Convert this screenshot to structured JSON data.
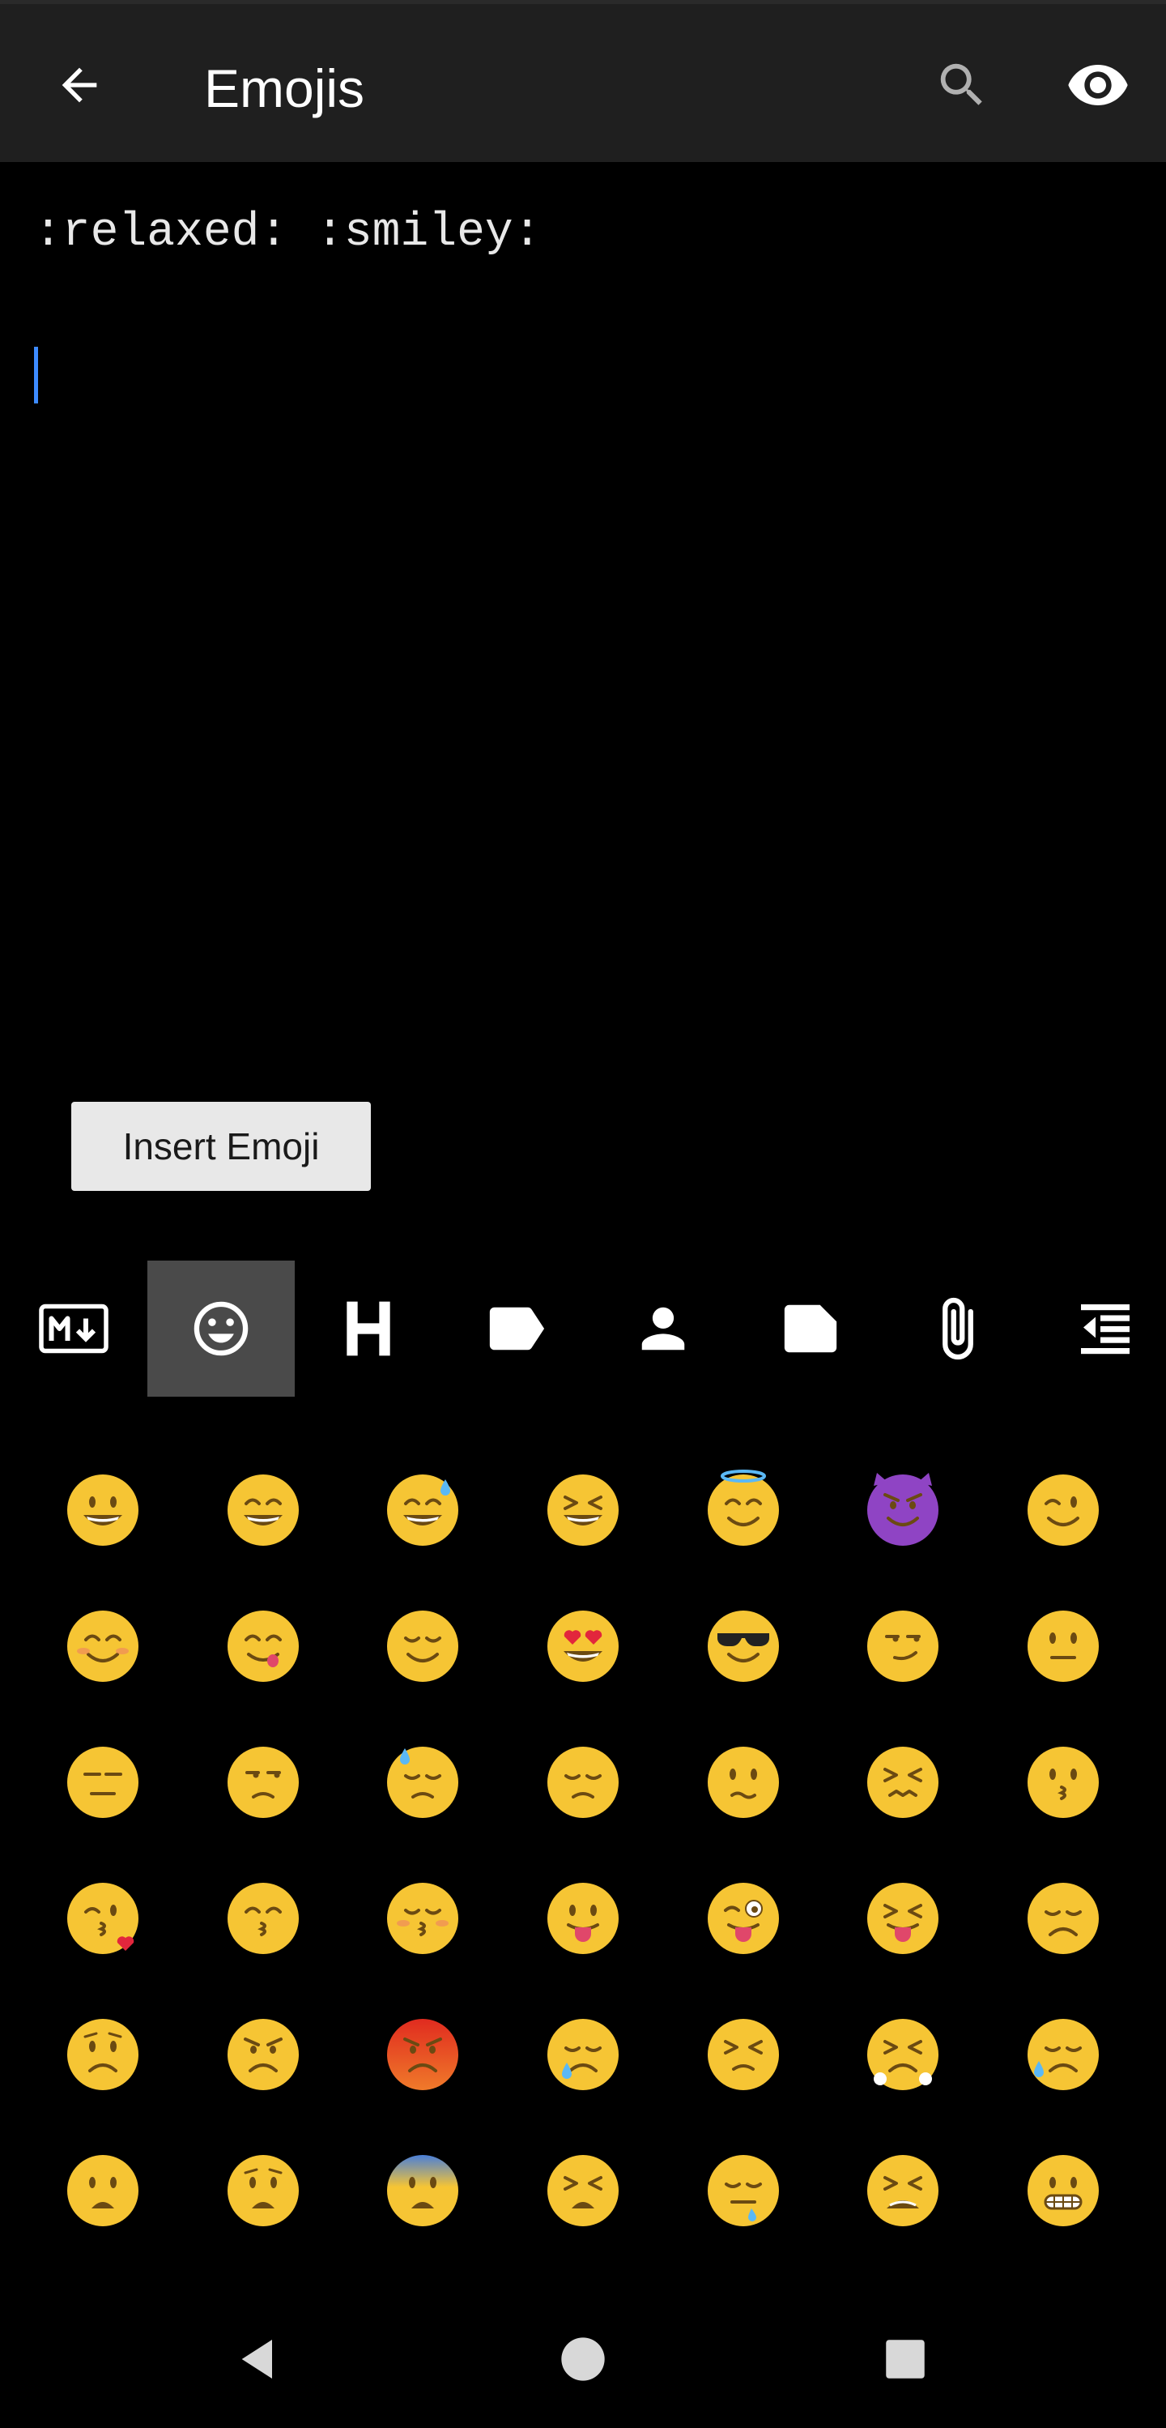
{
  "app_bar": {
    "title": "Emojis",
    "back_icon": "arrow-back-icon",
    "search_icon": "search-icon",
    "preview_icon": "eye-icon",
    "background": "#1f1f1f"
  },
  "editor": {
    "text": ":relaxed: :smiley:",
    "caret_color": "#3d8bff"
  },
  "insert_button": {
    "label": "Insert Emoji"
  },
  "toolbar": {
    "items": [
      {
        "name": "markdown-icon",
        "active": false
      },
      {
        "name": "emoji-icon",
        "active": true
      },
      {
        "name": "heading-icon",
        "active": false
      },
      {
        "name": "tag-icon",
        "active": false
      },
      {
        "name": "person-icon",
        "active": false
      },
      {
        "name": "note-icon",
        "active": false
      },
      {
        "name": "attachment-icon",
        "active": false
      },
      {
        "name": "format-indent-decrease-icon",
        "active": false
      }
    ],
    "active_bg": "#4a4a4a"
  },
  "emoji_grid": {
    "rows": [
      [
        {
          "name": "smiley",
          "face": "#f6c534",
          "eyes": "open",
          "mouth": "grin-open"
        },
        {
          "name": "smile",
          "face": "#f6c534",
          "eyes": "smile",
          "mouth": "grin-open"
        },
        {
          "name": "sweat-smile",
          "face": "#f6c534",
          "eyes": "smile",
          "mouth": "grin-open",
          "extra": "sweat"
        },
        {
          "name": "laughing",
          "face": "#f6c534",
          "eyes": "squint",
          "mouth": "grin-open"
        },
        {
          "name": "innocent",
          "face": "#f6c534",
          "eyes": "smile",
          "mouth": "smile",
          "extra": "halo"
        },
        {
          "name": "smiling-imp",
          "face": "#8f44c4",
          "eyes": "angry",
          "mouth": "smile",
          "extra": "horns"
        },
        {
          "name": "wink",
          "face": "#f6c534",
          "eyes": "wink",
          "mouth": "smile"
        }
      ],
      [
        {
          "name": "blush",
          "face": "#f6c534",
          "eyes": "smile",
          "mouth": "smile",
          "extra": "blush"
        },
        {
          "name": "yum",
          "face": "#f6c534",
          "eyes": "smile",
          "mouth": "tongue-side"
        },
        {
          "name": "relieved",
          "face": "#f6c534",
          "eyes": "closed",
          "mouth": "smile"
        },
        {
          "name": "heart-eyes",
          "face": "#f6c534",
          "eyes": "hearts",
          "mouth": "grin-open"
        },
        {
          "name": "sunglasses",
          "face": "#f6c534",
          "eyes": "shades",
          "mouth": "smile"
        },
        {
          "name": "smirk",
          "face": "#f6c534",
          "eyes": "side",
          "mouth": "smirk"
        },
        {
          "name": "neutral-face",
          "face": "#f6c534",
          "eyes": "open",
          "mouth": "flat"
        }
      ],
      [
        {
          "name": "expressionless",
          "face": "#f6c534",
          "eyes": "lines",
          "mouth": "flat"
        },
        {
          "name": "unamused",
          "face": "#f6c534",
          "eyes": "side",
          "mouth": "frown-small"
        },
        {
          "name": "sweat",
          "face": "#f6c534",
          "eyes": "closed-down",
          "mouth": "frown-small",
          "extra": "sweat-top"
        },
        {
          "name": "pensive",
          "face": "#f6c534",
          "eyes": "closed-down",
          "mouth": "frown-small"
        },
        {
          "name": "confused",
          "face": "#f6c534",
          "eyes": "open",
          "mouth": "wavy"
        },
        {
          "name": "confounded",
          "face": "#f6c534",
          "eyes": "squint",
          "mouth": "zigzag"
        },
        {
          "name": "kissing",
          "face": "#f6c534",
          "eyes": "open",
          "mouth": "kiss"
        }
      ],
      [
        {
          "name": "kissing-heart",
          "face": "#f6c534",
          "eyes": "wink",
          "mouth": "kiss",
          "extra": "heart"
        },
        {
          "name": "kissing-smiling-eyes",
          "face": "#f6c534",
          "eyes": "smile",
          "mouth": "kiss"
        },
        {
          "name": "kissing-closed-eyes",
          "face": "#f6c534",
          "eyes": "closed",
          "mouth": "kiss",
          "extra": "blush"
        },
        {
          "name": "stuck-out-tongue",
          "face": "#f6c534",
          "eyes": "open",
          "mouth": "tongue"
        },
        {
          "name": "stuck-out-tongue-winking-eye",
          "face": "#f6c534",
          "eyes": "crazy",
          "mouth": "tongue"
        },
        {
          "name": "stuck-out-tongue-closed-eyes",
          "face": "#f6c534",
          "eyes": "squint",
          "mouth": "tongue"
        },
        {
          "name": "disappointed",
          "face": "#f6c534",
          "eyes": "closed-down",
          "mouth": "frown"
        }
      ],
      [
        {
          "name": "worried",
          "face": "#f6c534",
          "eyes": "open",
          "mouth": "frown",
          "extra": "brows-worried"
        },
        {
          "name": "angry",
          "face": "#f6c534",
          "eyes": "angry",
          "mouth": "frown"
        },
        {
          "name": "rage",
          "face": "#e8452c",
          "eyes": "angry",
          "mouth": "frown"
        },
        {
          "name": "cry",
          "face": "#f6c534",
          "eyes": "closed-down",
          "mouth": "frown",
          "extra": "tear"
        },
        {
          "name": "persevere",
          "face": "#f6c534",
          "eyes": "squint",
          "mouth": "frown-small"
        },
        {
          "name": "triumph",
          "face": "#f6c534",
          "eyes": "squint",
          "mouth": "frown",
          "extra": "steam"
        },
        {
          "name": "disappointed-relieved",
          "face": "#f6c534",
          "eyes": "closed-down",
          "mouth": "frown",
          "extra": "sweat-left"
        }
      ],
      [
        {
          "name": "frowning",
          "face": "#f6c534",
          "eyes": "open",
          "mouth": "frown-open"
        },
        {
          "name": "anguished",
          "face": "#f6c534",
          "eyes": "open",
          "mouth": "frown-open",
          "extra": "brows-worried"
        },
        {
          "name": "cold-sweat",
          "face": "#f6c534",
          "eyes": "open",
          "mouth": "frown-open",
          "extra": "blue-top"
        },
        {
          "name": "weary",
          "face": "#f6c534",
          "eyes": "squint",
          "mouth": "frown-open"
        },
        {
          "name": "sleepy",
          "face": "#f6c534",
          "eyes": "closed-down",
          "mouth": "flat",
          "extra": "drop"
        },
        {
          "name": "tired-face",
          "face": "#f6c534",
          "eyes": "squint",
          "mouth": "grimace-open"
        },
        {
          "name": "grimacing",
          "face": "#f6c534",
          "eyes": "open",
          "mouth": "grimace"
        }
      ]
    ]
  },
  "nav_bar": {
    "back_icon": "nav-back-icon",
    "home_icon": "nav-home-icon",
    "recents_icon": "nav-recents-icon"
  }
}
